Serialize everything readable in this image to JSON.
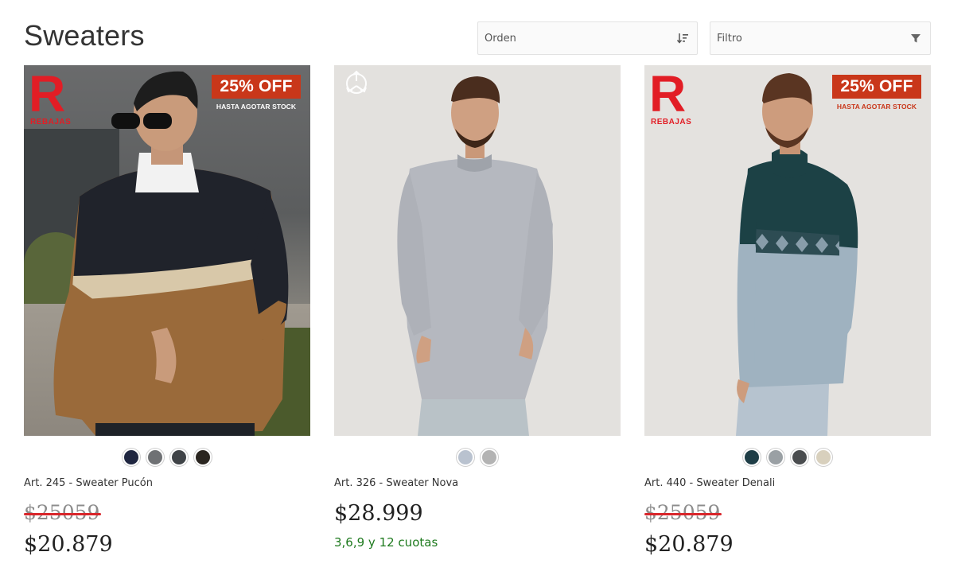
{
  "page": {
    "title": "Sweaters"
  },
  "controls": {
    "sort": {
      "label": "Orden",
      "icon": "sort-icon"
    },
    "filter": {
      "label": "Filtro",
      "icon": "filter-icon"
    }
  },
  "colors": {
    "sale_red": "#e21d25",
    "off_badge": "#c9371a",
    "installments_green": "#1e7a1e",
    "strike": "#d9262b"
  },
  "products": [
    {
      "name": "Art. 245 - Sweater Pucón",
      "old_price": "$25059",
      "price": "$20.879",
      "badge": {
        "letter": "R",
        "word": "REBAJAS",
        "off": "25% OFF",
        "stock": "HASTA AGOTAR STOCK"
      },
      "swatches": [
        "#1f2640",
        "#6f7174",
        "#3f4347",
        "#2a2520"
      ]
    },
    {
      "name": "Art. 326 - Sweater Nova",
      "price": "$28.999",
      "installments": "3,6,9 y 12 cuotas",
      "icon": "recycle-icon",
      "swatches": [
        "#b9c2cf",
        "#b3b3b3"
      ]
    },
    {
      "name": "Art. 440 - Sweater Denali",
      "old_price": "$25059",
      "price": "$20.879",
      "badge": {
        "letter": "R",
        "word": "REBAJAS",
        "off": "25% OFF",
        "stock": "HASTA AGOTAR STOCK"
      },
      "swatches": [
        "#1e3d46",
        "#9aa0a4",
        "#4a4d4f",
        "#d8d0bd"
      ]
    }
  ]
}
